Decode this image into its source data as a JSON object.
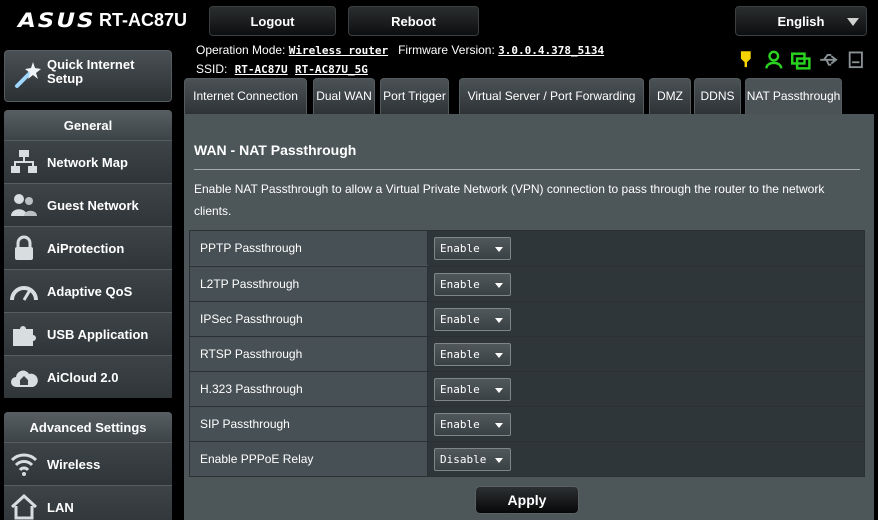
{
  "header": {
    "logo": "ASUS",
    "model": "RT-AC87U",
    "logout_label": "Logout",
    "reboot_label": "Reboot",
    "language": "English"
  },
  "info": {
    "opmode_label": "Operation Mode:",
    "opmode_value": "Wireless router",
    "firmware_label": "Firmware Version:",
    "firmware_value": "3.0.0.4.378_5134",
    "ssid_label": "SSID:",
    "ssid_values": [
      "RT-AC87U",
      "RT-AC87U_5G"
    ]
  },
  "sidebar": {
    "quick_setup": "Quick Internet Setup",
    "general_title": "General",
    "general_items": [
      {
        "label": "Network Map",
        "icon": "network-map-icon"
      },
      {
        "label": "Guest Network",
        "icon": "guest-network-icon"
      },
      {
        "label": "AiProtection",
        "icon": "lock-icon"
      },
      {
        "label": "Adaptive QoS",
        "icon": "gauge-icon"
      },
      {
        "label": "USB Application",
        "icon": "puzzle-icon"
      },
      {
        "label": "AiCloud 2.0",
        "icon": "cloud-home-icon"
      }
    ],
    "advanced_title": "Advanced Settings",
    "advanced_items": [
      {
        "label": "Wireless",
        "icon": "wifi-icon"
      },
      {
        "label": "LAN",
        "icon": "home-icon"
      }
    ]
  },
  "tabs": [
    {
      "label": "Internet Connection"
    },
    {
      "label": "Dual WAN"
    },
    {
      "label": "Port Trigger"
    },
    {
      "label": "Virtual Server / Port Forwarding"
    },
    {
      "label": "DMZ"
    },
    {
      "label": "DDNS"
    },
    {
      "label": "NAT Passthrough",
      "active": true
    }
  ],
  "main": {
    "title": "WAN - NAT Passthrough",
    "description": "Enable NAT Passthrough to allow a Virtual Private Network (VPN) connection to pass through the router to the network clients.",
    "rows": [
      {
        "label": "PPTP Passthrough",
        "value": "Enable"
      },
      {
        "label": "L2TP Passthrough",
        "value": "Enable"
      },
      {
        "label": "IPSec Passthrough",
        "value": "Enable"
      },
      {
        "label": "RTSP Passthrough",
        "value": "Enable"
      },
      {
        "label": "H.323 Passthrough",
        "value": "Enable"
      },
      {
        "label": "SIP Passthrough",
        "value": "Enable"
      },
      {
        "label": "Enable PPPoE Relay",
        "value": "Disable"
      }
    ],
    "apply_label": "Apply"
  },
  "colors": {
    "panel_bg": "#4d5659",
    "accent_yellow": "#f5d300",
    "accent_green": "#29d31f"
  }
}
